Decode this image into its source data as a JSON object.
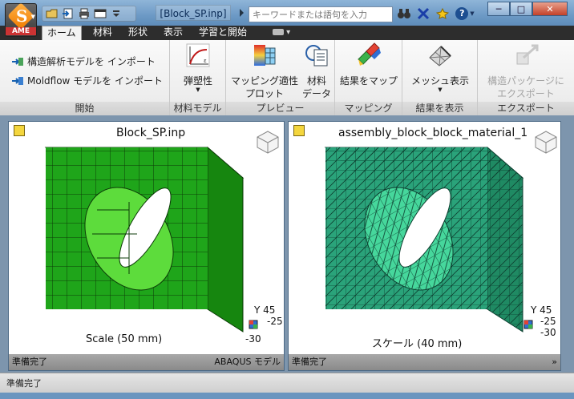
{
  "window": {
    "app_badge": "AME",
    "doc_title": "[Block_SP.inp]",
    "search_placeholder": "キーワードまたは語句を入力",
    "help_label": "?",
    "minimize": "─",
    "maximize": "□",
    "close": "✕"
  },
  "tabs": [
    {
      "label": "ホーム",
      "active": true
    },
    {
      "label": "材料"
    },
    {
      "label": "形状"
    },
    {
      "label": "表示"
    },
    {
      "label": "学習と開始"
    }
  ],
  "ribbon": {
    "start": {
      "group": "開始",
      "import_structural": "構造解析モデルを インポート",
      "import_moldflow": "Moldflow モデルを インポート"
    },
    "material": {
      "group": "材料モデル",
      "elastoplastic": "弾塑性"
    },
    "preview": {
      "group": "プレビュー",
      "mapping_plot_1": "マッピング適性",
      "mapping_plot_2": "プロット",
      "material_data_1": "材料",
      "material_data_2": "データ"
    },
    "mapping": {
      "group": "マッピング",
      "map_results": "結果をマップ"
    },
    "display": {
      "group": "結果を表示",
      "mesh_display": "メッシュ表示"
    },
    "export": {
      "group": "エクスポート",
      "export_1": "構造パッケージに",
      "export_2": "エクスポート"
    }
  },
  "viewports": [
    {
      "title": "Block_SP.inp",
      "scale": "Scale (50 mm)",
      "status": "準備完了",
      "status_right": "ABAQUS モデル",
      "coord_y": "Y 45",
      "coord_z": "-25",
      "coord_x": "-30",
      "mesh_color": "#1fa51a"
    },
    {
      "title": "assembly_block_block_material_1",
      "scale": "スケール (40 mm)",
      "status": "準備完了",
      "status_right": "»",
      "coord_y": "Y 45",
      "coord_z": "-25",
      "coord_x": "-30",
      "mesh_color": "#2aa37a"
    }
  ],
  "statusbar": {
    "text": "準備完了"
  }
}
